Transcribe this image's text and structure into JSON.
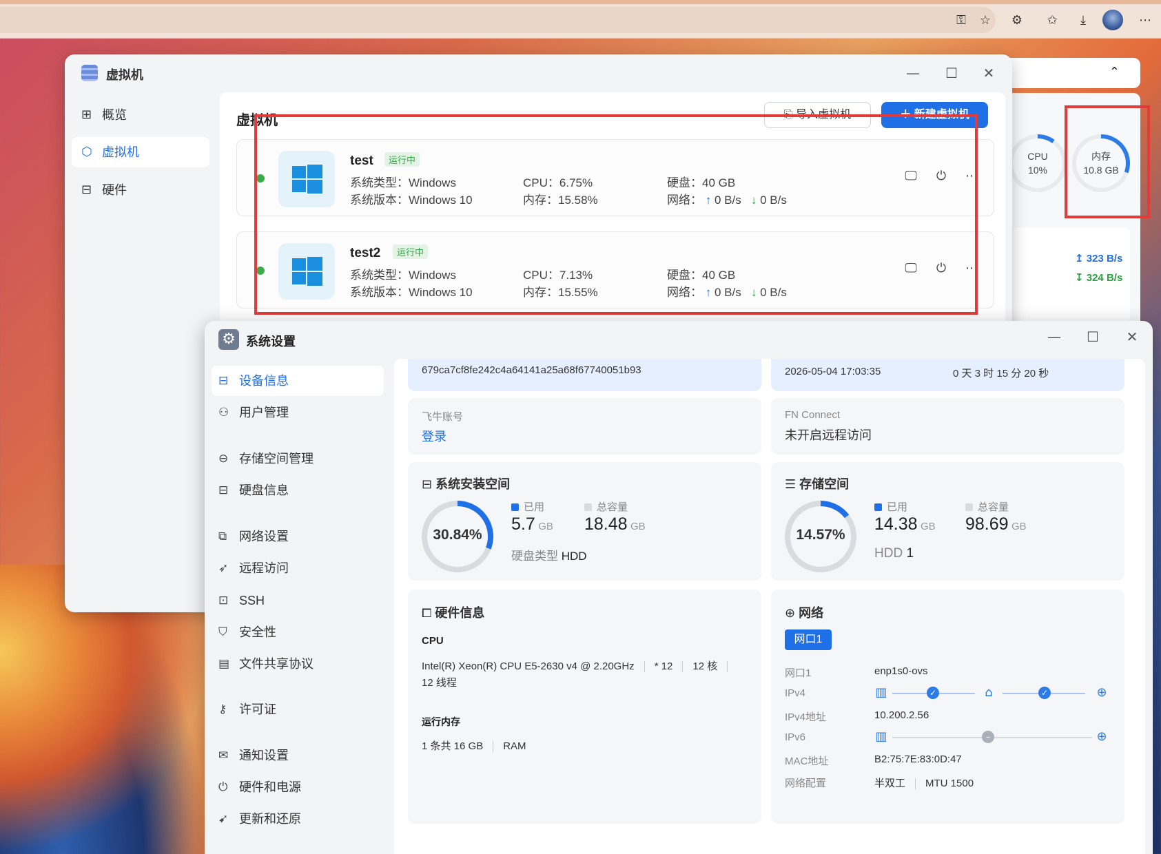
{
  "browser": {
    "icons": [
      "key-icon",
      "star-icon",
      "extensions-icon",
      "favorites-icon",
      "download-icon",
      "avatar",
      "more-icon"
    ]
  },
  "background": {
    "cpu_label": "CPU",
    "cpu_value": "10%",
    "cpu_percent": 10,
    "mem_label": "内存",
    "mem_value": "10.8 GB",
    "upload": "323 B/s",
    "download": "324 B/s"
  },
  "vm_window": {
    "title": "虚拟机",
    "sidebar": [
      {
        "label": "概览",
        "icon": "grid-icon"
      },
      {
        "label": "虚拟机",
        "icon": "cube-icon"
      },
      {
        "label": "硬件",
        "icon": "drive-icon"
      }
    ],
    "main_title": "虚拟机",
    "import_label": "导入虚拟机",
    "new_label": "新建虚拟机",
    "vms": [
      {
        "name": "test",
        "status": "运行中",
        "type_label": "系统类型：",
        "type": "Windows",
        "version_label": "系统版本：",
        "version": "Windows 10",
        "cpu_label": "CPU：",
        "cpu": "6.75%",
        "mem_label": "内存：",
        "mem": "15.58%",
        "disk_label": "硬盘：",
        "disk": "40 GB",
        "net_label": "网络：",
        "up": "0 B/s",
        "down": "0 B/s"
      },
      {
        "name": "test2",
        "status": "运行中",
        "type_label": "系统类型：",
        "type": "Windows",
        "version_label": "系统版本：",
        "version": "Windows 10",
        "cpu_label": "CPU：",
        "cpu": "7.13%",
        "mem_label": "内存：",
        "mem": "15.55%",
        "disk_label": "硬盘：",
        "disk": "40 GB",
        "net_label": "网络：",
        "up": "0 B/s",
        "down": "0 B/s"
      }
    ]
  },
  "settings": {
    "title": "系统设置",
    "nav": [
      {
        "label": "设备信息",
        "icon": "drive-icon"
      },
      {
        "label": "用户管理",
        "icon": "users-icon"
      },
      {
        "label": "存储空间管理",
        "icon": "storage-icon"
      },
      {
        "label": "硬盘信息",
        "icon": "disk-icon"
      },
      {
        "label": "网络设置",
        "icon": "network-icon"
      },
      {
        "label": "远程访问",
        "icon": "send-icon"
      },
      {
        "label": "SSH",
        "icon": "terminal-icon"
      },
      {
        "label": "安全性",
        "icon": "shield-icon"
      },
      {
        "label": "文件共享协议",
        "icon": "document-icon"
      },
      {
        "label": "许可证",
        "icon": "key-icon"
      },
      {
        "label": "通知设置",
        "icon": "mail-icon"
      },
      {
        "label": "硬件和电源",
        "icon": "power-icon"
      },
      {
        "label": "更新和还原",
        "icon": "rocket-icon"
      }
    ],
    "device_id": "679ca7cf8fe242c4a64141a25a68f67740051b93",
    "datetime": "2026-05-04 17:03:35",
    "uptime": "0 天 3 时 15 分 20 秒",
    "account": {
      "label": "飞牛账号",
      "action": "登录"
    },
    "fn_connect": {
      "label": "FN Connect",
      "value": "未开启远程访问"
    },
    "system_space": {
      "title": "系统安装空间",
      "percent_text": "30.84%",
      "percent": 30.84,
      "used_label": "已用",
      "used": "5.7",
      "used_unit": "GB",
      "total_label": "总容量",
      "total": "18.48",
      "total_unit": "GB",
      "disk_type_label": "硬盘类型",
      "disk_type": "HDD"
    },
    "storage_space": {
      "title": "存储空间",
      "percent_text": "14.57%",
      "percent": 14.57,
      "used_label": "已用",
      "used": "14.38",
      "used_unit": "GB",
      "total_label": "总容量",
      "total": "98.69",
      "total_unit": "GB",
      "hdd_label": "HDD",
      "hdd_count": "1"
    },
    "hardware": {
      "title": "硬件信息",
      "cpu_heading": "CPU",
      "cpu_model": "Intel(R) Xeon(R) CPU E5-2630 v4 @ 2.20GHz",
      "cpu_mult": "* 12",
      "cpu_cores": "12 核",
      "cpu_threads": "12 线程",
      "mem_heading": "运行内存",
      "mem_value": "1 条共 16 GB",
      "mem_type": "RAM"
    },
    "network": {
      "title": "网络",
      "tab": "网口1",
      "rows": [
        {
          "label": "网口1",
          "value": "enp1s0-ovs"
        },
        {
          "label": "IPv4",
          "value": ""
        },
        {
          "label": "IPv4地址",
          "value": "10.200.2.56"
        },
        {
          "label": "IPv6",
          "value": ""
        },
        {
          "label": "MAC地址",
          "value": "B2:75:7E:83:0D:47"
        },
        {
          "label": "网络配置",
          "value": "半双工"
        }
      ],
      "mtu": "MTU 1500"
    }
  }
}
